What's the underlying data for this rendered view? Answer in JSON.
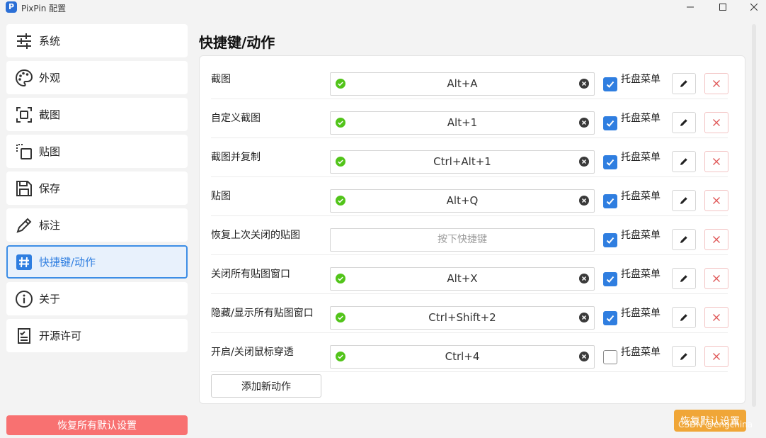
{
  "window": {
    "title": "PixPin 配置",
    "app_icon_letter": "P",
    "controls": [
      "minimize",
      "maximize",
      "close"
    ]
  },
  "sidebar": {
    "items": [
      {
        "label": "系统",
        "icon": "sliders-icon"
      },
      {
        "label": "外观",
        "icon": "palette-icon"
      },
      {
        "label": "截图",
        "icon": "screenshot-frame-icon"
      },
      {
        "label": "贴图",
        "icon": "pin-copy-icon"
      },
      {
        "label": "保存",
        "icon": "save-icon"
      },
      {
        "label": "标注",
        "icon": "pencil-icon"
      },
      {
        "label": "快捷键/动作",
        "icon": "hash-icon",
        "active": true
      },
      {
        "label": "关于",
        "icon": "info-icon"
      },
      {
        "label": "开源许可",
        "icon": "license-icon"
      }
    ],
    "reset_all_label": "恢复所有默认设置"
  },
  "main": {
    "title": "快捷键/动作",
    "tray_label": "托盘菜单",
    "rows": [
      {
        "label": "截图",
        "hotkey": "Alt+A",
        "tray": true
      },
      {
        "label": "自定义截图",
        "hotkey": "Alt+1",
        "tray": true
      },
      {
        "label": "截图并复制",
        "hotkey": "Ctrl+Alt+1",
        "tray": true
      },
      {
        "label": "贴图",
        "hotkey": "Alt+Q",
        "tray": true
      },
      {
        "label": "恢复上次关闭的贴图",
        "hotkey": "",
        "tray": true
      },
      {
        "label": "关闭所有贴图窗口",
        "hotkey": "Alt+X",
        "tray": true
      },
      {
        "label": "隐藏/显示所有贴图窗口",
        "hotkey": "Ctrl+Shift+2",
        "tray": true
      },
      {
        "label": "开启/关闭鼠标穿透",
        "hotkey": "Ctrl+4",
        "tray": false
      }
    ],
    "hotkey_placeholder": "按下快捷键",
    "add_action_label": "添加新动作",
    "reset_defaults_label": "恢复默认设置"
  },
  "watermark": "CSDN @engchina",
  "colors": {
    "accent": "#2f7ee0",
    "ok_green": "#52c41a",
    "danger": "#f87171",
    "warning": "#f0a637"
  }
}
